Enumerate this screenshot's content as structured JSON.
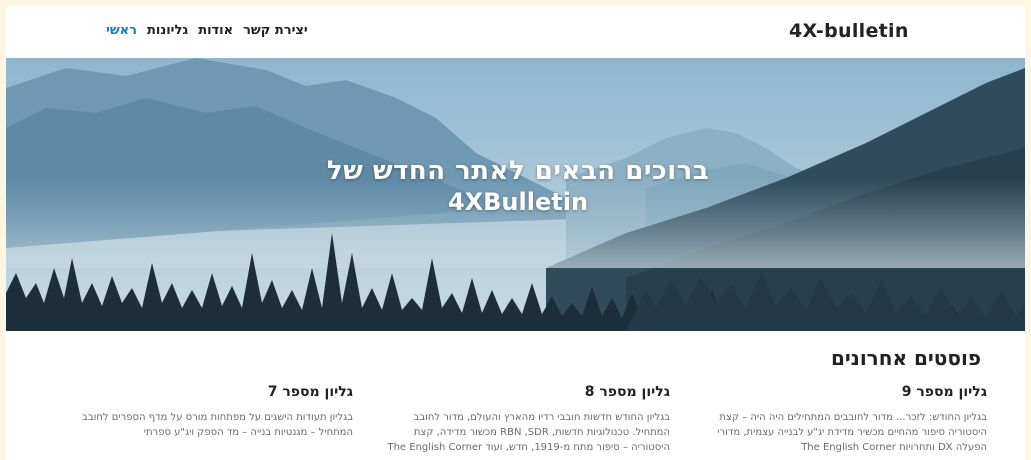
{
  "header": {
    "brand": "4X-bulletin",
    "nav": [
      "ראשי",
      "גליונות",
      "אודות",
      "יצירת קשר"
    ],
    "active_index": 0,
    "accent_color": "#1a7fb8"
  },
  "hero": {
    "line1": "ברוכים הבאים לאתר החדש של",
    "line2": "4XBulletin"
  },
  "recent": {
    "title": "פוסטים אחרונים",
    "posts": [
      {
        "title": "גליון מספר 9",
        "excerpt": "בגליון החודש: לזכר... מדור לחובבים המתחילים היה היה – קצת היסטוריה סיפור מהחיים מכשיר מדידת יג\"ע לבנייה עצמית, מדורי הפעלה DX ותחרויות The English Corner"
      },
      {
        "title": "גליון מספר 8",
        "excerpt": "בגליון החודש חדשות חובבי רדיו מהארץ והעולם, מדור לחובב המתחיל. טכנולוגיות חדשות, RBN ,SDR מכשור מדידה, קצת היסטוריה – סיפור מתח מ-1919, חדש, ועוד The English Corner"
      },
      {
        "title": "גליון מספר 7",
        "excerpt": "בגליון תעודות הישגים על מפתחות מורס על מדף הספרים לחובב המתחיל – מגנטיות בנייה – מד הספק ויג\"ע ספרתי"
      }
    ]
  }
}
